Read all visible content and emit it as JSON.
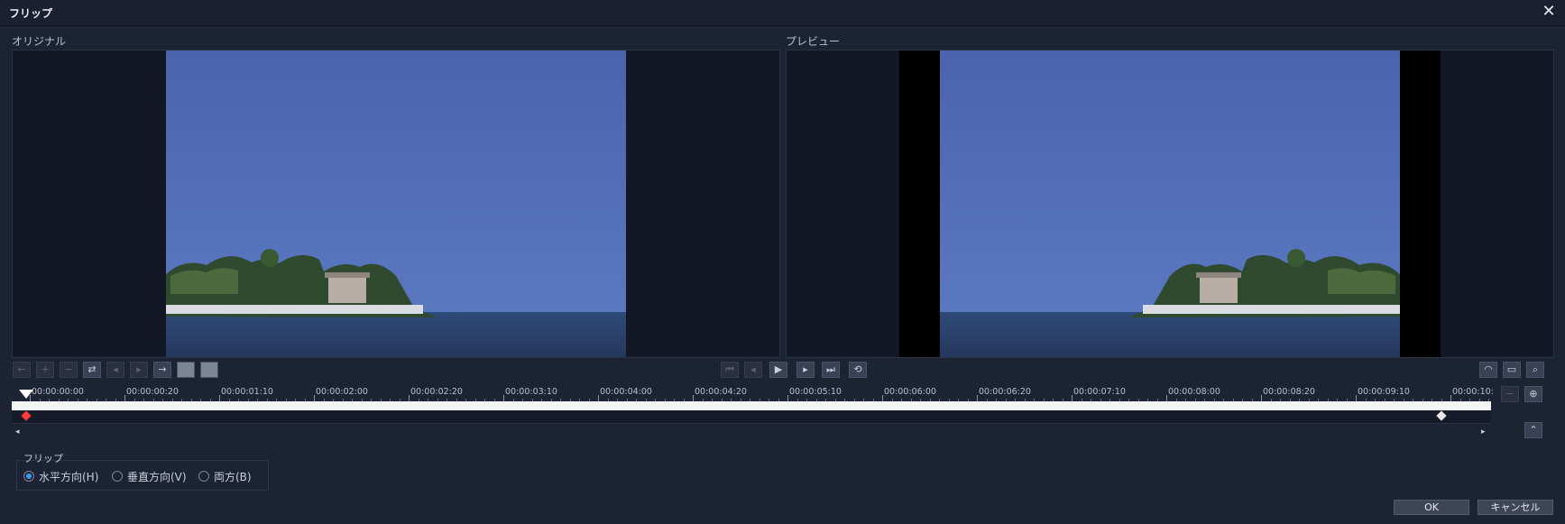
{
  "window": {
    "title": "フリップ",
    "close_icon": "✕"
  },
  "panels": {
    "original_label": "オリジナル",
    "preview_label": "プレビュー"
  },
  "timeline": {
    "labels": [
      "00:00:00:00",
      "00:00:00:20",
      "00:00:01:10",
      "00:00:02:00",
      "00:00:02:20",
      "00:00:03:10",
      "00:00:04:00",
      "00:00:04:20",
      "00:00:05:10",
      "00:00:06:00",
      "00:00:06:20",
      "00:00:07:10",
      "00:00:08:00",
      "00:00:08:20",
      "00:00:09:10",
      "00:00:10:"
    ]
  },
  "flip": {
    "group_label": "フリップ",
    "options": [
      {
        "label": "水平方向(H)",
        "selected": true
      },
      {
        "label": "垂直方向(V)",
        "selected": false
      },
      {
        "label": "両方(B)",
        "selected": false
      }
    ]
  },
  "buttons": {
    "ok": "OK",
    "cancel": "キャンセル"
  },
  "colors": {
    "accent": "#2ea0ff",
    "sky": "#4a65ae",
    "sea": "#2b3d66"
  }
}
